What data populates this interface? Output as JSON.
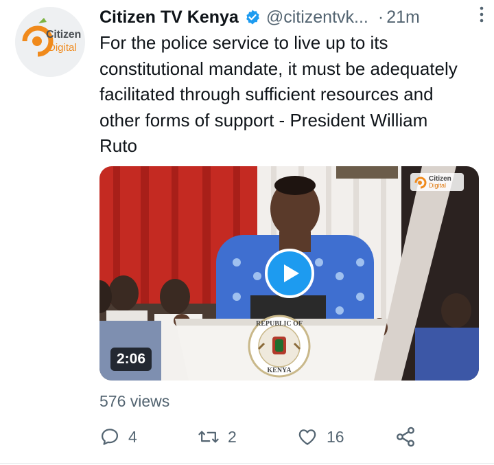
{
  "tweet": {
    "display_name": "Citizen TV Kenya",
    "handle": "@citizentvk...",
    "separator": "·",
    "time": "21m",
    "text": "For the police service to live up to its constitutional mandate, it must be adequately facilitated through sufficient resources and other forms of support - President William Ruto"
  },
  "avatar": {
    "logo_line1": "Citizen",
    "logo_line2": "Digital"
  },
  "media": {
    "duration": "2:06",
    "podium_seal_text_top": "REPUBLIC OF",
    "podium_seal_text_bottom": "KENYA",
    "watermark_line1": "Citizen",
    "watermark_line2": "Digital"
  },
  "stats": {
    "views": "576 views"
  },
  "actions": {
    "reply_count": "4",
    "retweet_count": "2",
    "like_count": "16"
  },
  "icons": {
    "verified": "verified-badge-icon",
    "more": "more-vertical-icon",
    "play": "play-icon",
    "reply": "reply-icon",
    "retweet": "retweet-icon",
    "like": "heart-icon",
    "share": "share-icon"
  },
  "colors": {
    "brand_blue": "#1d9bf0",
    "text_primary": "#0f1419",
    "text_secondary": "#536471",
    "citizen_orange": "#f08a1c"
  }
}
